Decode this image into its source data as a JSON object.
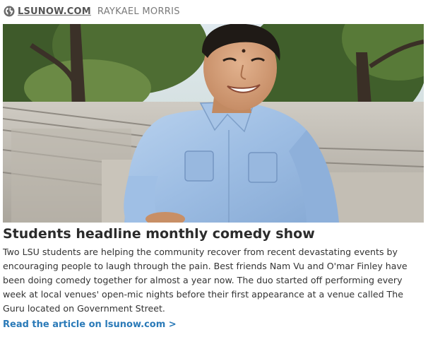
{
  "source": {
    "icon": "globe-icon",
    "domain": "LSUNOW.COM",
    "author": "RAYKAEL MORRIS"
  },
  "article": {
    "image_alt": "Smiling student in a light blue shirt sitting on stone amphitheater steps under trees",
    "headline": "Students headline monthly comedy show",
    "summary": "Two LSU students are helping the community recover from recent devastating events by encouraging people to laugh through the pain. Best friends Nam Vu and O'mar Finley have been doing comedy together for almost a year now. The duo started off performing every week at local venues' open-mic nights before their first appearance at a venue called The Guru located on Government Street.",
    "read_more": "Read the article on lsunow.com >"
  },
  "colors": {
    "link": "#2a7ab8",
    "headline": "#2b2b2b",
    "meta": "#7a7a7a"
  }
}
